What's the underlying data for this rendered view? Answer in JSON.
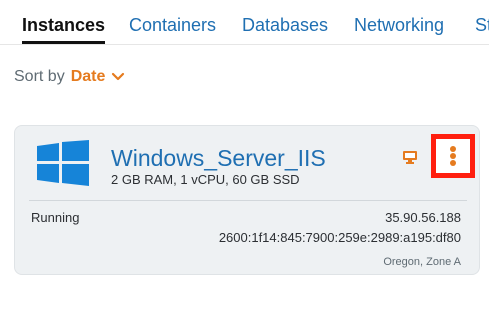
{
  "tabs": [
    {
      "label": "Instances",
      "active": true
    },
    {
      "label": "Containers",
      "active": false
    },
    {
      "label": "Databases",
      "active": false
    },
    {
      "label": "Networking",
      "active": false
    },
    {
      "label": "St",
      "active": false
    }
  ],
  "sort": {
    "label": "Sort by",
    "value": "Date",
    "icon": "chevron-down-icon"
  },
  "instance": {
    "name": "Windows_Server_IIS",
    "specs": "2 GB RAM, 1 vCPU, 60 GB SSD",
    "status": "Running",
    "ipv4": "35.90.56.188",
    "ipv6": "2600:1f14:845:7900:259e:2989:a195:df80",
    "location": "Oregon, Zone A",
    "os_icon": "windows-logo-icon",
    "connect_icon": "monitor-icon",
    "menu_icon": "kebab-menu-icon"
  },
  "colors": {
    "link_blue": "#1f6fb2",
    "accent_orange": "#e57b1f",
    "card_background": "#eef1f3",
    "highlight_red": "#ff1f0f",
    "windows_blue": "#1684d8"
  }
}
